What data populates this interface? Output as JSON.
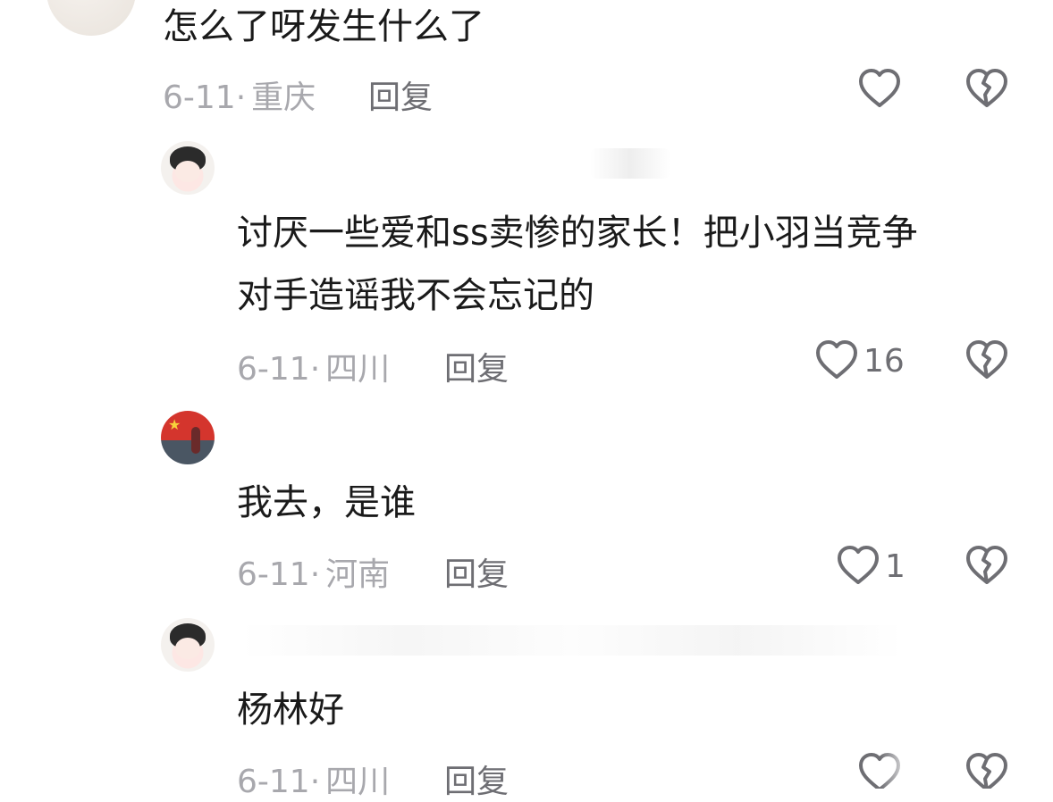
{
  "comments": [
    {
      "text_lines": [
        "怎么了呀发生什么了"
      ],
      "date": "6-11",
      "location": "重庆",
      "reply_label": "回复",
      "like_count": ""
    },
    {
      "text_lines": [
        "讨厌一些爱和ss卖惨的家长！把小羽当竞争",
        "对手造谣我不会忘记的"
      ],
      "date": "6-11",
      "location": "四川",
      "reply_label": "回复",
      "like_count": "16"
    },
    {
      "text_lines": [
        "我去，是谁"
      ],
      "date": "6-11",
      "location": "河南",
      "reply_label": "回复",
      "like_count": "1"
    },
    {
      "text_lines": [
        "杨林好"
      ],
      "date": "6-11",
      "location": "四川",
      "reply_label": "回复",
      "like_count": ""
    }
  ],
  "meta_separator": "·",
  "icons": {
    "like": "heart-outline-icon",
    "dislike": "broken-heart-icon"
  },
  "colors": {
    "text": "#1a1a1a",
    "meta": "#a8a8ad",
    "reply": "#6e6e73",
    "icon": "#6e6e73"
  }
}
